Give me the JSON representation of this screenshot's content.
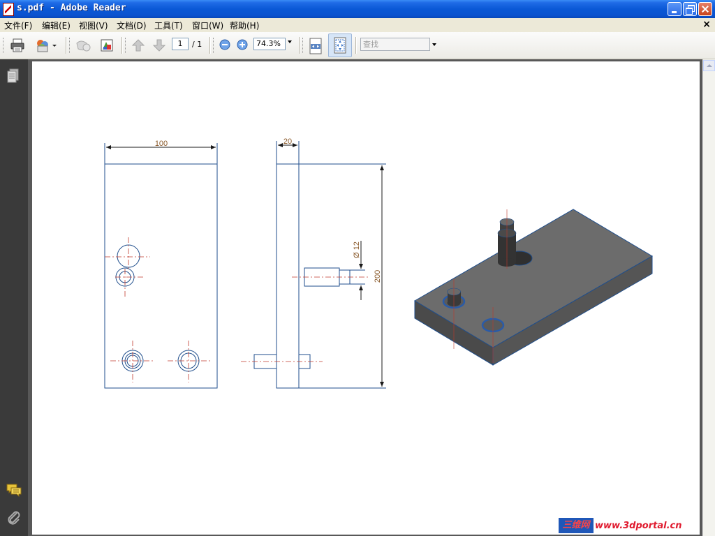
{
  "window": {
    "title": "s.pdf - Adobe Reader"
  },
  "menu": {
    "items": [
      "文件(F)",
      "编辑(E)",
      "视图(V)",
      "文档(D)",
      "工具(T)",
      "窗口(W)",
      "帮助(H)"
    ],
    "close_glyph": "×"
  },
  "toolbar": {
    "page_current": "1",
    "page_total": "/ 1",
    "zoom": "74.3%",
    "search_placeholder": "查找",
    "icons": [
      "print-icon",
      "email-icon",
      "hand-icon",
      "color-icon",
      "prev-page-icon",
      "next-page-icon",
      "zoom-out-icon",
      "zoom-in-icon",
      "fit-width-icon",
      "fit-page-icon"
    ]
  },
  "navpane": {
    "icons": [
      "pages-icon",
      "comments-icon",
      "attachments-icon"
    ]
  },
  "drawing": {
    "dim_width": "100",
    "dim_thickness": "20",
    "dim_height": "200",
    "dim_diameter": "Ø 12",
    "colors": {
      "line": "#1f4e8c",
      "dim": "#8a5a2b",
      "center": "#c0392b",
      "solid_top": "#6f6f6f",
      "solid_side": "#505050"
    }
  },
  "watermark": {
    "cn": "三维网",
    "url": "www.3dportal.cn"
  }
}
